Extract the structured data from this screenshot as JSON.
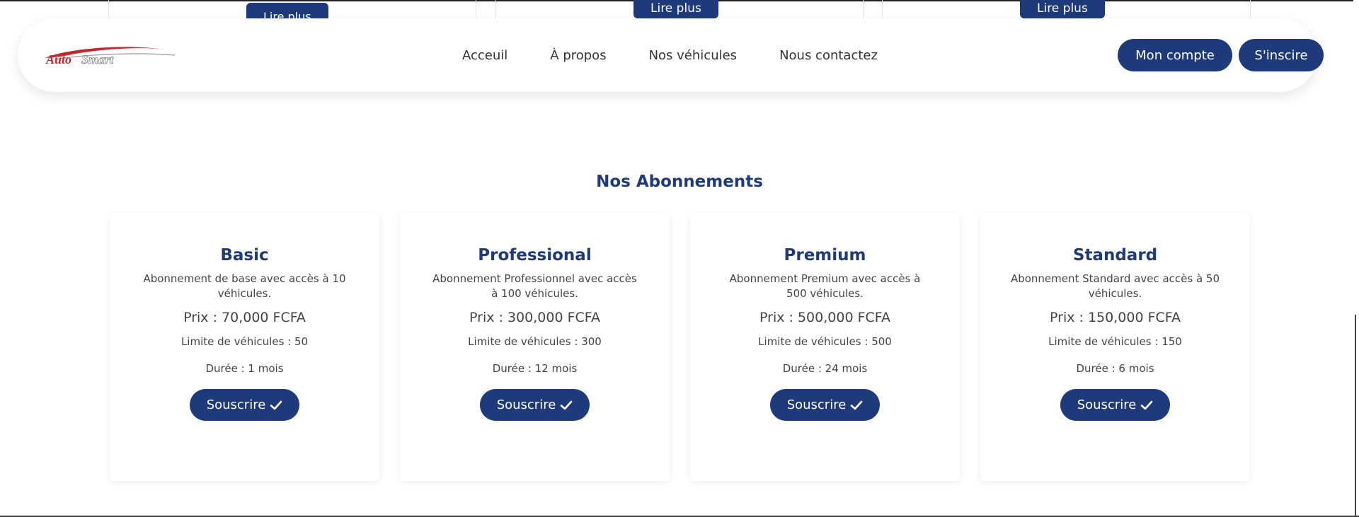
{
  "top": {
    "read_more_labels": [
      "Lire plus",
      "Lire plus",
      "Lire plus"
    ]
  },
  "navbar": {
    "logo_text": "AutoSmart",
    "links": [
      "Acceuil",
      "À propos",
      "Nos véhicules",
      "Nous contactez"
    ],
    "account_label": "Mon compte",
    "signup_label": "S'inscire"
  },
  "section": {
    "title": "Nos Abonnements"
  },
  "plans": [
    {
      "name": "Basic",
      "description": "Abonnement de base avec accès à 10 véhicules.",
      "price": "Prix : 70,000 FCFA",
      "limit": "Limite de véhicules : 50",
      "duration": "Durée : 1 mois",
      "cta": "Souscrire"
    },
    {
      "name": "Professional",
      "description": "Abonnement Professionnel avec accès à 100 véhicules.",
      "price": "Prix : 300,000 FCFA",
      "limit": "Limite de véhicules : 300",
      "duration": "Durée : 12 mois",
      "cta": "Souscrire"
    },
    {
      "name": "Premium",
      "description": "Abonnement Premium avec accès à 500 véhicules.",
      "price": "Prix : 500,000 FCFA",
      "limit": "Limite de véhicules : 500",
      "duration": "Durée : 24 mois",
      "cta": "Souscrire"
    },
    {
      "name": "Standard",
      "description": "Abonnement Standard avec accès à 50 véhicules.",
      "price": "Prix : 150,000 FCFA",
      "limit": "Limite de véhicules : 150",
      "duration": "Durée : 6 mois",
      "cta": "Souscrire"
    }
  ],
  "colors": {
    "primary": "#1e3a7b",
    "logo_red": "#c0282d"
  },
  "icons": {
    "subscribe": "check-icon"
  }
}
